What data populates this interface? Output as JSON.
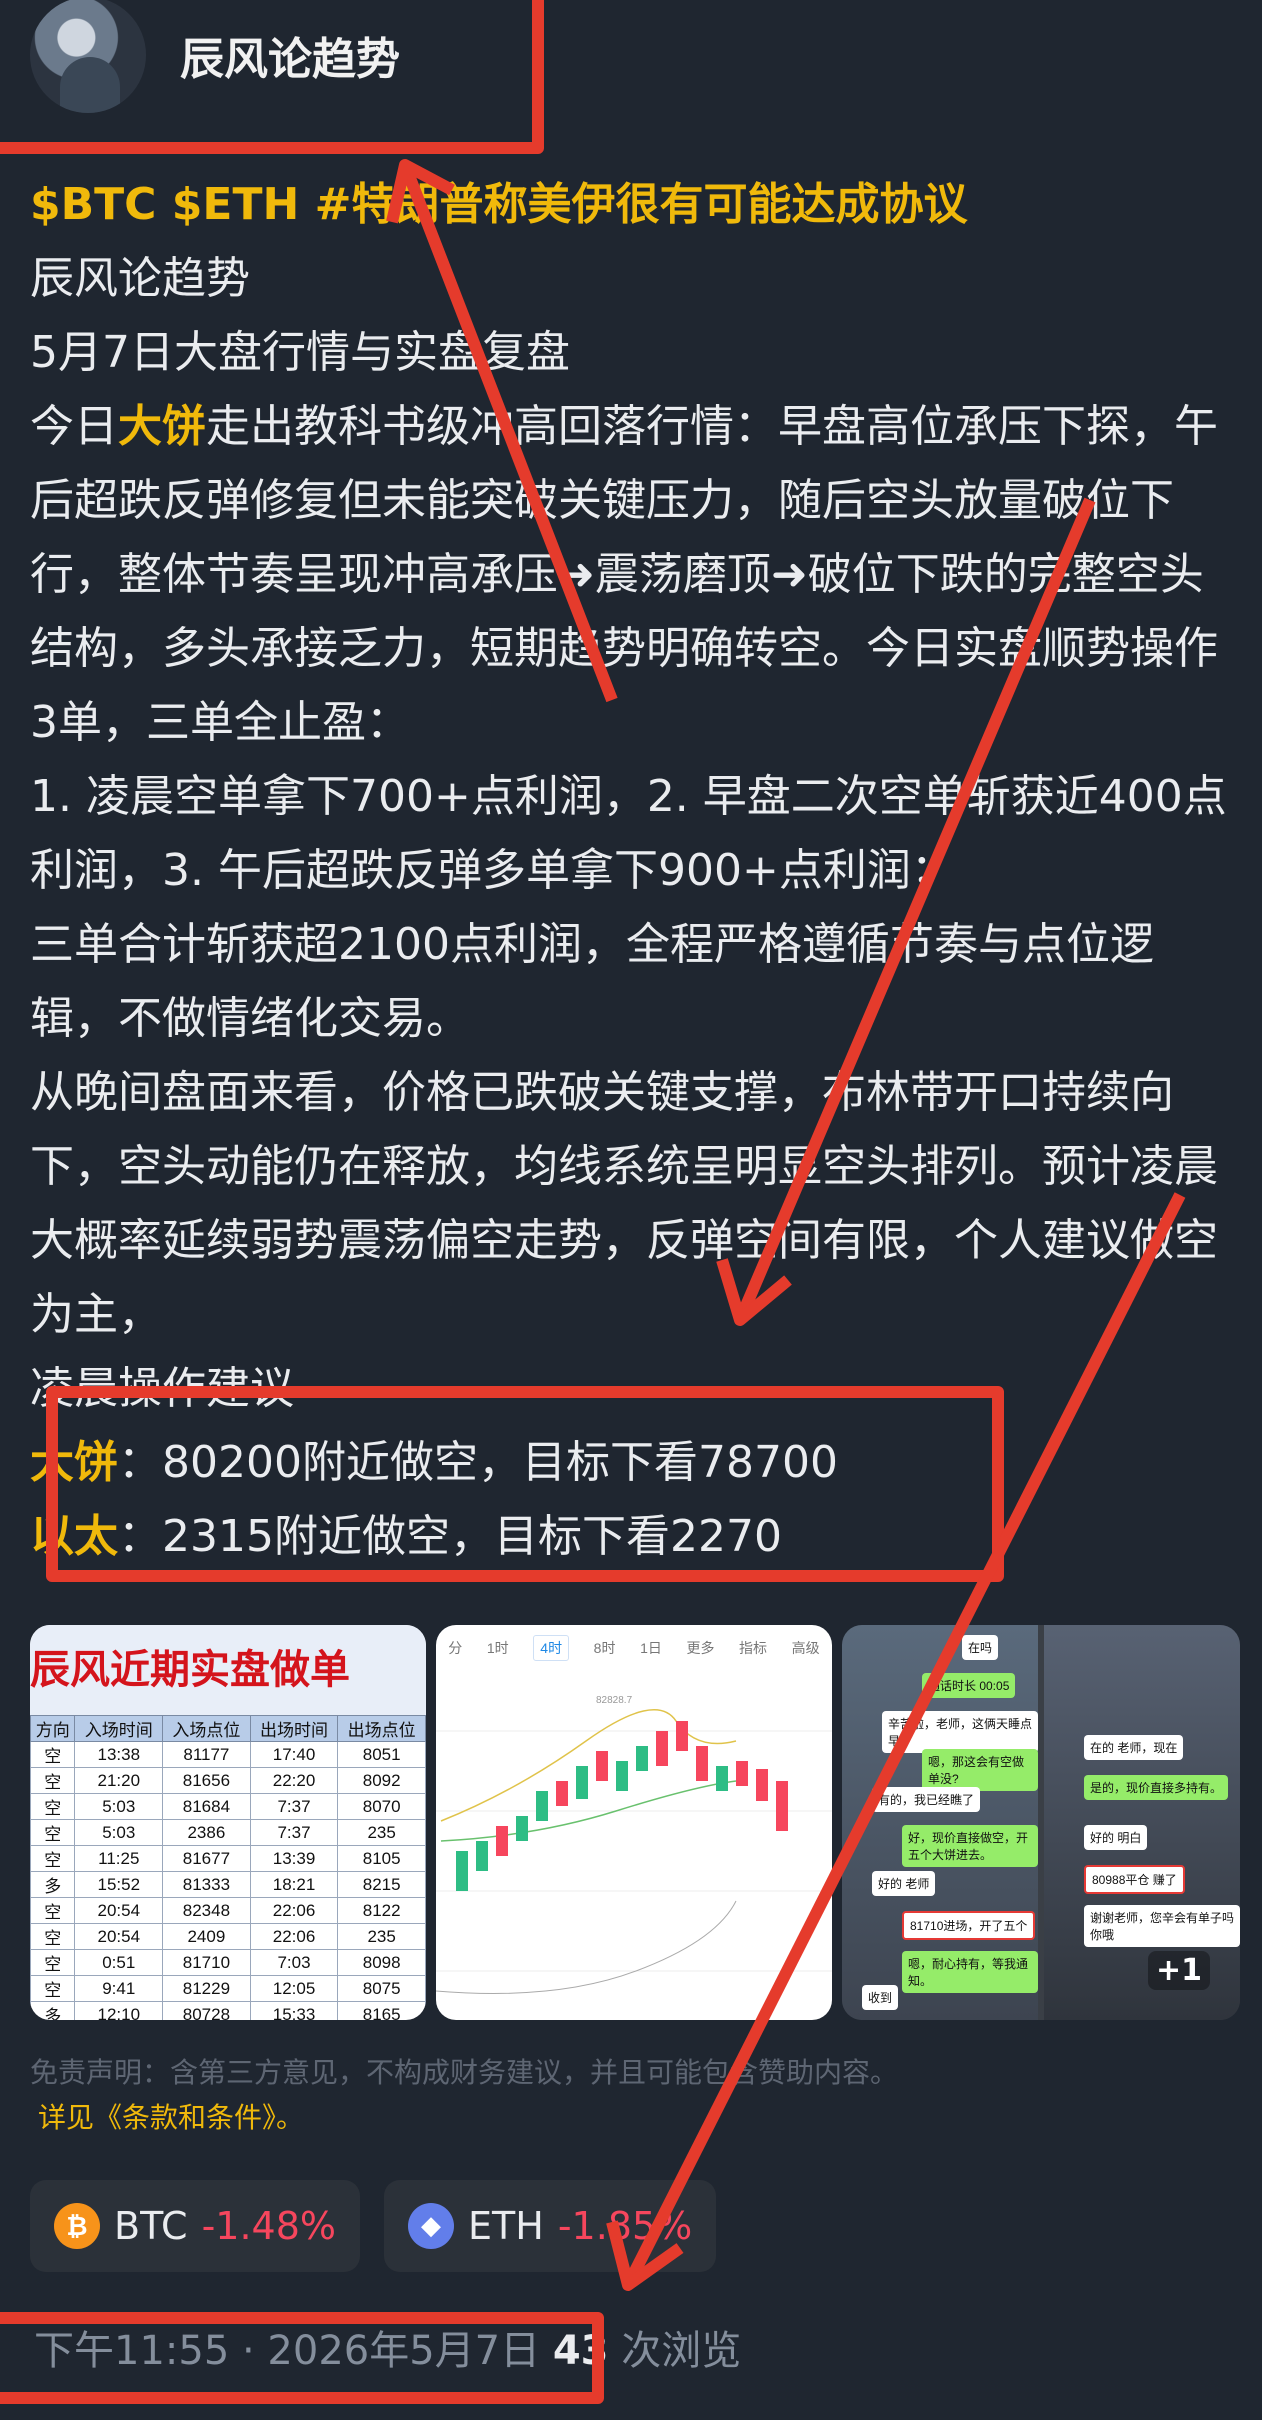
{
  "author": {
    "name": "辰风论趋势"
  },
  "post": {
    "line1": "$BTC $ETH #特朗普称美伊很有可能达成协议",
    "line2": "辰风论趋势",
    "line3": "5月7日大盘行情与实盘复盘",
    "p1_prefix": "今日",
    "p1_hl": "大饼",
    "p1_rest": "走出教科书级冲高回落行情：早盘高位承压下探，午后超跌反弹修复但未能突破关键压力，随后空头放量破位下行，整体节奏呈现冲高承压➜震荡磨顶➜破位下跌的完整空头结构，多头承接乏力，短期趋势明确转空。今日实盘顺势操作3单，三单全止盈：",
    "p2": "1. 凌晨空单拿下700+点利润，2. 早盘二次空单斩获近400点利润，3. 午后超跌反弹多单拿下900+点利润；",
    "p3": "三单合计斩获超2100点利润，全程严格遵循节奏与点位逻辑，不做情绪化交易。",
    "p4": "从晚间盘面来看，价格已跌破关键支撑，布林带开口持续向下，空头动能仍在释放，均线系统呈明显空头排列。预计凌晨大概率延续弱势震荡偏空走势，反弹空间有限，个人建议做空为主，",
    "p5": "凌晨操作建议",
    "btc_label": "大饼",
    "btc_text": "：80200附近做空，目标下看78700",
    "eth_label": "以太",
    "eth_text": "：2315附近做空，目标下看2270"
  },
  "images": {
    "table_title": "辰风近期实盘做单",
    "table_headers": [
      "方向",
      "入场时间",
      "入场点位",
      "出场时间",
      "出场点位"
    ],
    "table_rows": [
      [
        "空",
        "13:38",
        "81177",
        "17:40",
        "8051"
      ],
      [
        "空",
        "21:20",
        "81656",
        "22:20",
        "8092"
      ],
      [
        "空",
        "5:03",
        "81684",
        "7:37",
        "8070"
      ],
      [
        "空",
        "5:03",
        "2386",
        "7:37",
        "235"
      ],
      [
        "空",
        "11:25",
        "81677",
        "13:39",
        "8105"
      ],
      [
        "多",
        "15:52",
        "81333",
        "18:21",
        "8215"
      ],
      [
        "空",
        "20:54",
        "82348",
        "22:06",
        "8122"
      ],
      [
        "空",
        "20:54",
        "2409",
        "22:06",
        "235"
      ],
      [
        "空",
        "0:51",
        "81710",
        "7:03",
        "8098"
      ],
      [
        "空",
        "9:41",
        "81229",
        "12:05",
        "8075"
      ],
      [
        "多",
        "12:10",
        "80728",
        "15:33",
        "8165"
      ]
    ],
    "chart_tabs": [
      "分",
      "1时",
      "4时",
      "8时",
      "1日",
      "更多",
      "指标",
      "高级"
    ],
    "chart_high_label": "82828.7",
    "chat_bubbles": [
      "在吗",
      "通话时长 00:05",
      "辛苦啦，老师，这俩天睡点早。",
      "嗯，那这会有空做单没?",
      "有的，我已经瞧了",
      "好，现价直接做空，开五个大饼进去。",
      "好的 老师",
      "81710进场，开了五个",
      "嗯，耐心持有，等我通知。",
      "收到"
    ],
    "chat_bubbles_right": [
      "在的 老师，现在",
      "是的，现价直接多持有。",
      "好的 明白",
      "80988平仓 赚了",
      "谢谢老师，您辛会有单子吗 你哦"
    ],
    "more_count": "+1"
  },
  "disclaimer": {
    "text": "免责声明：含第三方意见，不构成财务建议，并且可能包含赞助内容。",
    "link": "详见《条款和条件》。"
  },
  "tickers": [
    {
      "symbol": "BTC",
      "change": "-1.48%"
    },
    {
      "symbol": "ETH",
      "change": "-1.85%"
    }
  ],
  "meta": {
    "time": "下午11:55 · 2026年5月7日",
    "views_count": "43",
    "views_suffix": "次浏览"
  },
  "colors": {
    "accent": "#f0b90b",
    "negative": "#f6465d",
    "annotation": "#e53b2c"
  }
}
